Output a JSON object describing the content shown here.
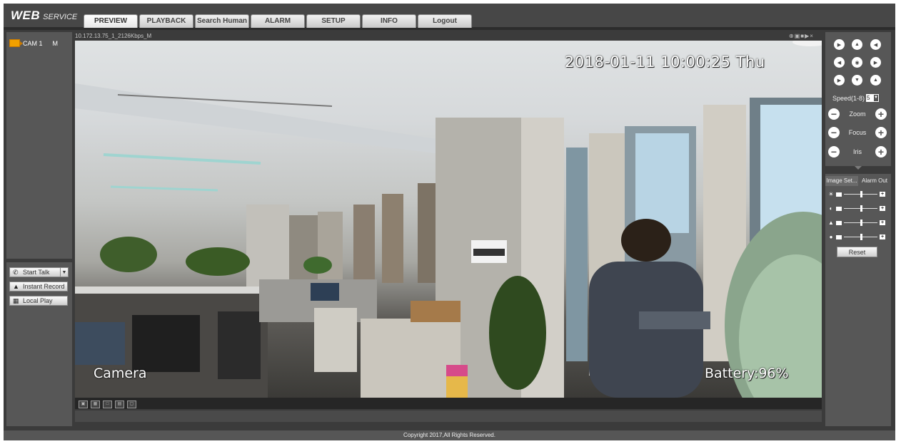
{
  "app": {
    "logo_main": "WEB",
    "logo_sub": "SERVICE"
  },
  "nav": {
    "tabs": [
      {
        "label": "PREVIEW",
        "active": true
      },
      {
        "label": "PLAYBACK"
      },
      {
        "label": "Search Human"
      },
      {
        "label": "ALARM"
      },
      {
        "label": "SETUP"
      },
      {
        "label": "INFO"
      },
      {
        "label": "Logout"
      }
    ]
  },
  "channels": [
    {
      "name": "CAM 1",
      "stream": "M"
    }
  ],
  "left_actions": {
    "start_talk": "Start Talk",
    "instant_record": "Instant Record",
    "local_play": "Local Play"
  },
  "video": {
    "stream_info": "10.172.13.75_1_2126Kbps_M",
    "osd_time": "2018-01-11 10:00:25 Thu",
    "osd_name": "Camera",
    "osd_battery": "Battery:96%"
  },
  "ptz": {
    "speed_label": "Speed(1-8)",
    "speed_value": "5",
    "zoom_label": "Zoom",
    "focus_label": "Focus",
    "iris_label": "Iris"
  },
  "image_settings": {
    "tab_image": "Image Set...",
    "tab_alarm": "Alarm Out",
    "sliders": [
      {
        "icon": "brightness-icon",
        "value": 0.5
      },
      {
        "icon": "contrast-icon",
        "value": 0.5
      },
      {
        "icon": "saturation-icon",
        "value": 0.5
      },
      {
        "icon": "hue-icon",
        "value": 0.5
      }
    ],
    "reset_label": "Reset"
  },
  "footer": {
    "copyright": "Copyright 2017,All Rights Reserved."
  },
  "colors": {
    "background": "#3b3b3b",
    "panel": "#575757",
    "cam_icon": "#f0a000"
  }
}
